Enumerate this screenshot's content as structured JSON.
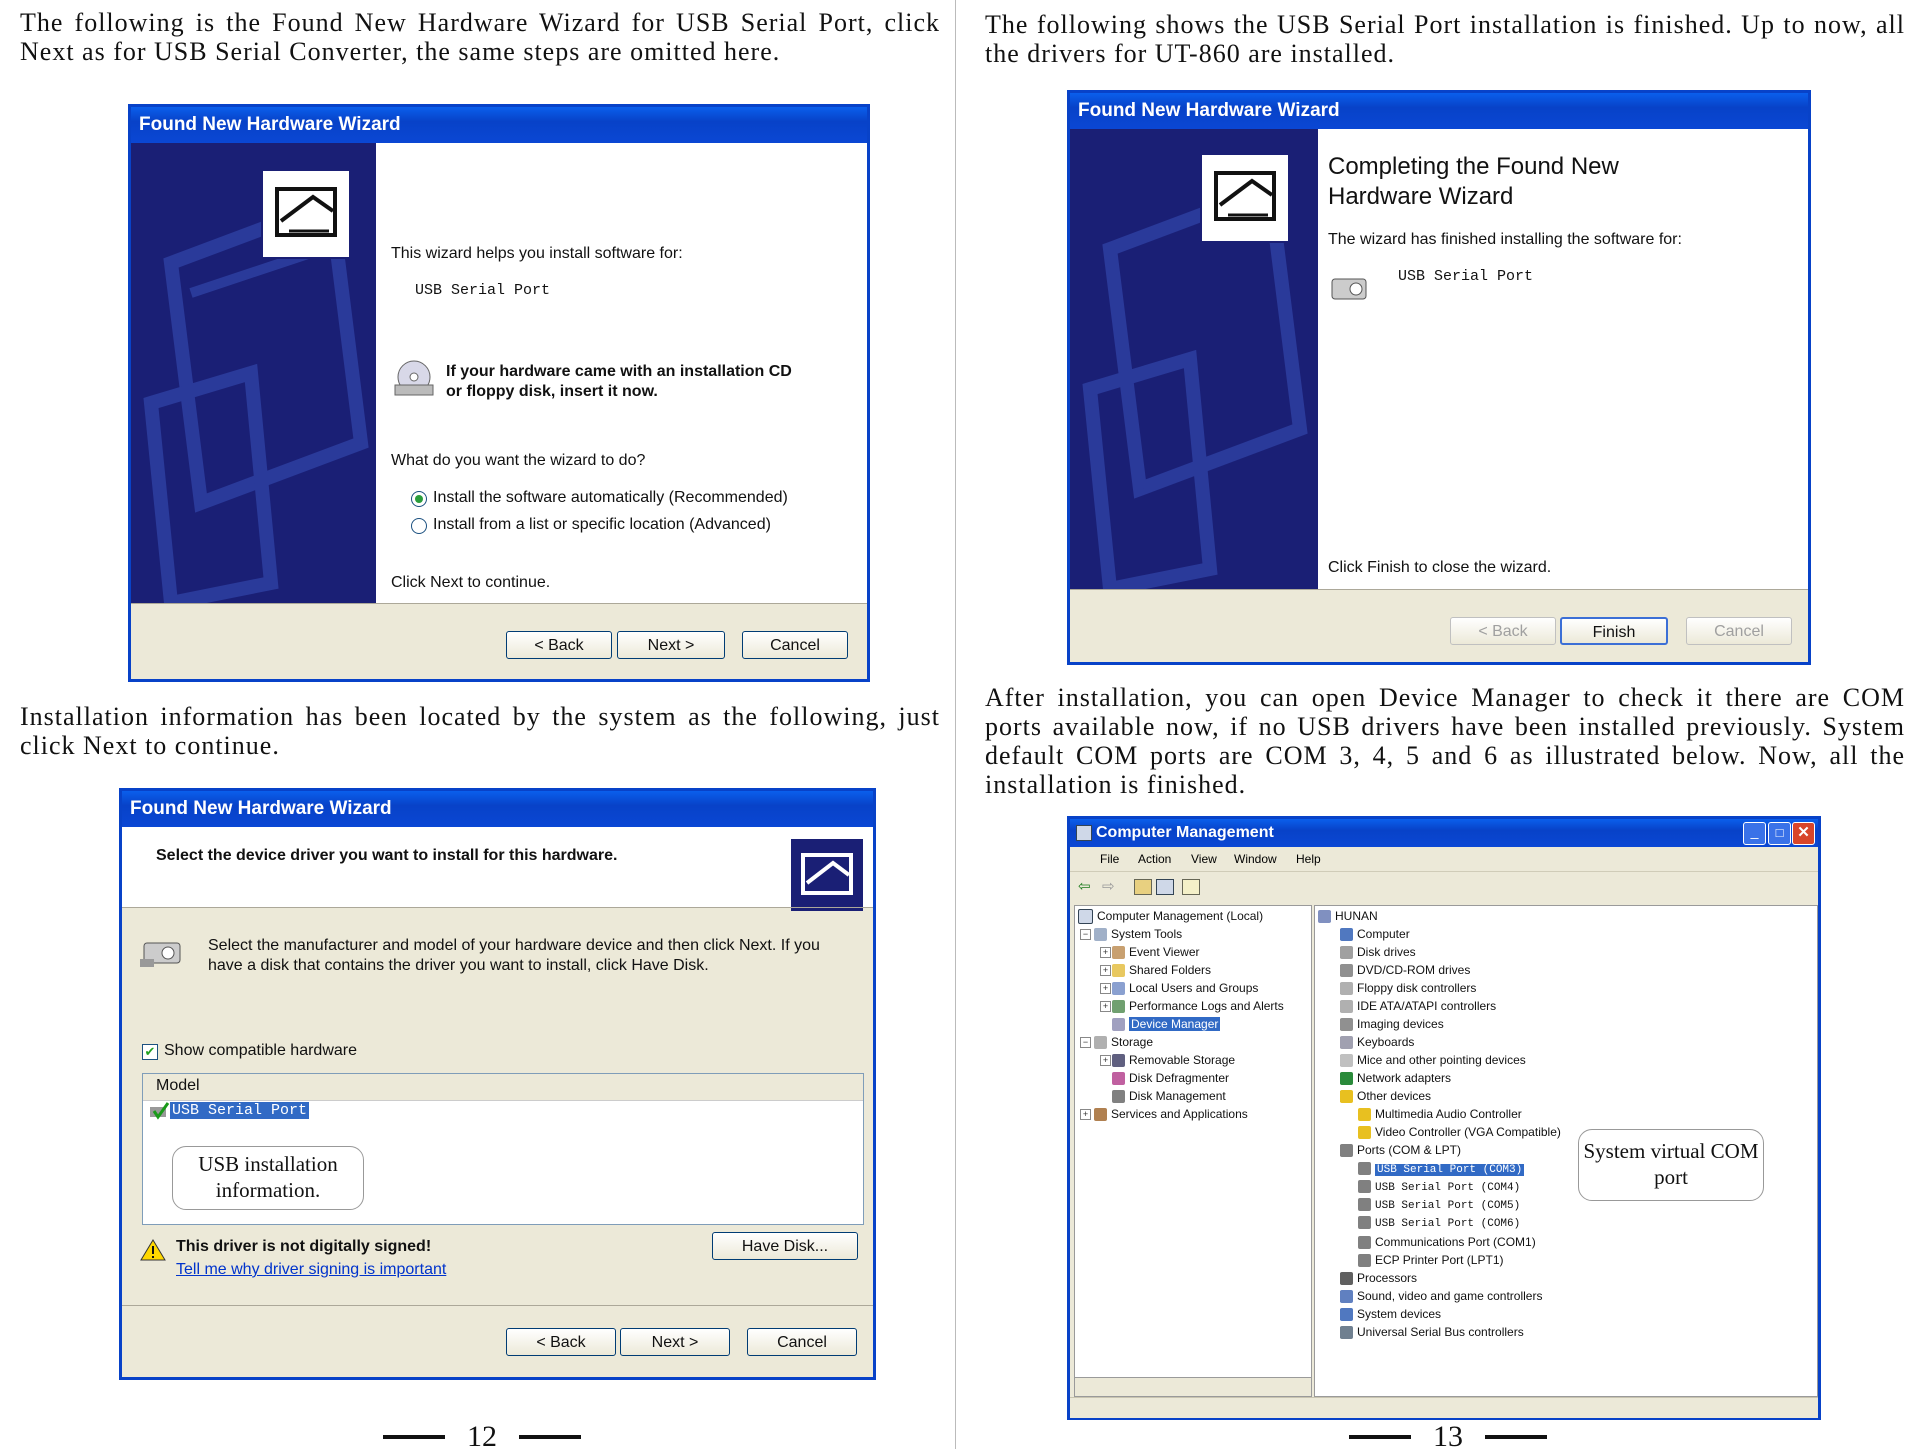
{
  "left_page": {
    "para1": "The following is the Found New Hardware Wizard for USB Serial Port, click Next as for USB Serial Converter, the same steps are omitted here.",
    "para2": "Installation information has been located by the system as the following, just click Next to continue.",
    "page_number": "12"
  },
  "right_page": {
    "para1": "The following shows the USB Serial Port installation is finished. Up to now, all  the drivers for UT-860 are installed.",
    "para2": "After installation, you can open Device Manager to check it there are COM ports available now, if no USB drivers have been installed previously. System default COM ports are COM 3, 4, 5 and 6 as illustrated below. Now, all the installation is finished.",
    "page_number": "13"
  },
  "wizard1": {
    "title": "Found New Hardware Wizard",
    "intro": "This wizard helps you install software for:",
    "device": "USB Serial Port",
    "cd_line1": "If your hardware came with an installation CD",
    "cd_line2": "or floppy disk, insert it now.",
    "question": "What do you want the wizard to do?",
    "option1": "Install the software automatically (Recommended)",
    "option2": "Install from a list or specific location (Advanced)",
    "continue_text": "Click Next to continue.",
    "back": "< Back",
    "next": "Next >",
    "cancel": "Cancel"
  },
  "wizard2": {
    "title": "Found New Hardware Wizard",
    "header": "Select the device driver you want to install for this hardware.",
    "desc1": "Select the manufacturer and model of your hardware device and then click Next. If you",
    "desc2": "have a disk that contains the driver you want to install, click Have Disk.",
    "show_compatible": "Show compatible hardware",
    "model_header": "Model",
    "model_item": "USB Serial Port",
    "callout": "USB installation information.",
    "warning": "This driver is not digitally signed!",
    "warning_link": "Tell me why driver signing is important",
    "have_disk": "Have Disk...",
    "back": "< Back",
    "next": "Next >",
    "cancel": "Cancel"
  },
  "wizard3": {
    "title": "Found New Hardware Wizard",
    "heading1": "Completing the Found New",
    "heading2": "Hardware Wizard",
    "finished_text": "The wizard has finished installing the software for:",
    "device": "USB Serial Port",
    "close_text": "Click Finish to close the wizard.",
    "back": "< Back",
    "finish": "Finish",
    "cancel": "Cancel"
  },
  "computer_management": {
    "title": "Computer Management",
    "menu": [
      "File",
      "Action",
      "View",
      "Window",
      "Help"
    ],
    "left_tree": [
      "Computer Management (Local)",
      "System Tools",
      "Event Viewer",
      "Shared Folders",
      "Local Users and Groups",
      "Performance Logs and Alerts",
      "Device Manager",
      "Storage",
      "Removable Storage",
      "Disk Defragmenter",
      "Disk Management",
      "Services and Applications"
    ],
    "right_tree": [
      "HUNAN",
      "Computer",
      "Disk drives",
      "DVD/CD-ROM drives",
      "Floppy disk controllers",
      "IDE ATA/ATAPI controllers",
      "Imaging devices",
      "Keyboards",
      "Mice and other pointing devices",
      "Network adapters",
      "Other devices",
      "Multimedia Audio Controller",
      "Video Controller (VGA Compatible)",
      "Ports (COM & LPT)",
      "USB Serial Port (COM3)",
      "USB Serial Port (COM4)",
      "USB Serial Port (COM5)",
      "USB Serial Port (COM6)",
      "Communications Port (COM1)",
      "ECP Printer Port (LPT1)",
      "Processors",
      "Sound, video and game controllers",
      "System devices",
      "Universal Serial Bus controllers"
    ],
    "callout": "System virtual COM port"
  },
  "colors": {
    "xp_blue": "#0842c8",
    "wizard_side": "#1a1f75",
    "dialog_bg": "#ece9d8",
    "selection": "#316ac5"
  }
}
